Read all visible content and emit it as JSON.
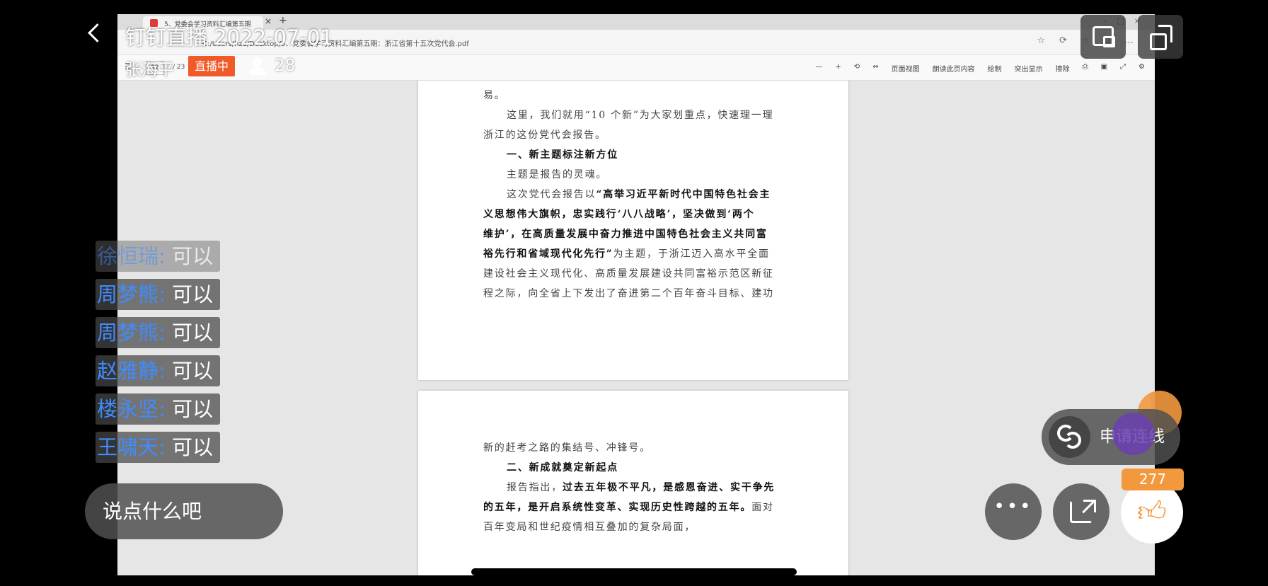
{
  "live": {
    "title": "钉钉直播 2022-07-01",
    "host": "张海平",
    "badge": "直播中",
    "viewers": "28",
    "likes": "277",
    "connect_label": "申请连线",
    "input_placeholder": "说点什么吧"
  },
  "comments": [
    {
      "name": "徐恒瑞:",
      "text": "可以"
    },
    {
      "name": "周梦熊:",
      "text": "可以"
    },
    {
      "name": "周梦熊:",
      "text": "可以"
    },
    {
      "name": "赵雅静:",
      "text": "可以"
    },
    {
      "name": "楼永坚:",
      "text": "可以"
    },
    {
      "name": "王啸天:",
      "text": "可以"
    }
  ],
  "browser": {
    "tab_title": "5、党委会学习资料汇编第五期",
    "address": "C:/Users/hzu/Desktop/5、党委会学习资料汇编第五期：浙江省第十五次党代会.pdf",
    "page_current": "12",
    "page_total": "/ 23",
    "tools": [
      "—",
      "+",
      "⟲",
      "⇔",
      "页面视图",
      "朗读此页内容",
      "绘制",
      "突出显示",
      "擦除"
    ]
  },
  "pdf": {
    "page_a": [
      "易。",
      "这里，我们就用“10 个新”为大家划重点，快速理一理",
      "浙江的这份党代会报告。",
      "一、新主题标注新方位",
      "主题是报告的灵魂。",
      "这次党代会报告以",
      "“高举习近平新时代中国特色社会主",
      "义思想伟大旗帜，忠实践行‘八八战略’，坚决做到‘两个",
      "维护’，在高质量发展中奋力推进中国特色社会主义共同富",
      "裕先行和省域现代化先行”",
      "为主题，于浙江迈入高水平全面",
      "建设社会主义现代化、高质量发展建设共同富裕示范区新征",
      "程之际，向全省上下发出了奋进第二个百年奋斗目标、建功"
    ],
    "page_b": [
      "新的赶考之路的集结号、冲锋号。",
      "二、新成就奠定新起点",
      "报告指出，",
      "过去五年极不平凡，是感恩奋进、实干争先",
      "的五年，是开启系统性变革、实现历史性跨越的五年。",
      "面对",
      "百年变局和世纪疫情相互叠加的复杂局面，"
    ]
  },
  "colors": {
    "live_badge": "#f05a28",
    "comment_name": "#3f8cff",
    "like_accent": "#f2993e",
    "connect_avatar": "#6a3fb0"
  },
  "icons": [
    "back-icon",
    "viewer-icon",
    "pip-icon",
    "rotate-screen-icon",
    "connect-icon",
    "more-icon",
    "share-icon",
    "like-icon"
  ]
}
